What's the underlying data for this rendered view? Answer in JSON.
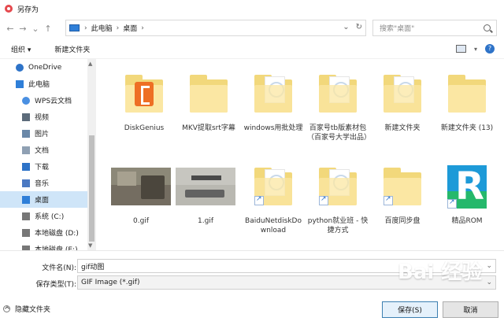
{
  "window": {
    "title": "另存为"
  },
  "address": {
    "crumbs": [
      "此电脑",
      "桌面"
    ],
    "placeholder": "搜索\"桌面\""
  },
  "toolbar": {
    "organize": "组织 ▾",
    "new_folder": "新建文件夹"
  },
  "sidebar": {
    "items": [
      {
        "label": "OneDrive",
        "icon": "cloud"
      },
      {
        "label": "此电脑",
        "icon": "computer"
      },
      {
        "label": "WPS云文档",
        "icon": "cloud"
      },
      {
        "label": "视频",
        "icon": "video"
      },
      {
        "label": "图片",
        "icon": "pictures"
      },
      {
        "label": "文档",
        "icon": "documents"
      },
      {
        "label": "下载",
        "icon": "download"
      },
      {
        "label": "音乐",
        "icon": "music"
      },
      {
        "label": "桌面",
        "icon": "desktop",
        "selected": true
      },
      {
        "label": "系统 (C:)",
        "icon": "drive"
      },
      {
        "label": "本地磁盘 (D:)",
        "icon": "drive"
      },
      {
        "label": "本地磁盘 (E:)",
        "icon": "drive"
      }
    ]
  },
  "files": [
    {
      "name": "DiskGenius",
      "kind": "folder-genius"
    },
    {
      "name": "MKV提取srt字幕",
      "kind": "folder"
    },
    {
      "name": "windows用批处理",
      "kind": "folder-doc"
    },
    {
      "name": "百家号tb版素材包（百家号大学出品）",
      "kind": "folder-doc"
    },
    {
      "name": "新建文件夹",
      "kind": "folder-doc"
    },
    {
      "name": "新建文件夹 (13)",
      "kind": "folder"
    },
    {
      "name": "0.gif",
      "kind": "photo"
    },
    {
      "name": "1.gif",
      "kind": "photo2"
    },
    {
      "name": "BaiduNetdiskDownload",
      "kind": "shortcut-folder"
    },
    {
      "name": "python就业班 - 快捷方式",
      "kind": "shortcut-folder"
    },
    {
      "name": "百度同步盘",
      "kind": "shortcut-folder"
    },
    {
      "name": "精品ROM",
      "kind": "r-icon"
    }
  ],
  "bottom": {
    "filename_label": "文件名(N):",
    "filename_value": "gif动图",
    "filetype_label": "保存类型(T):",
    "filetype_value": "GIF Image (*.gif)",
    "hide_folders": "隐藏文件夹",
    "save": "保存(S)",
    "cancel": "取消"
  },
  "watermark": "Bai 经验"
}
